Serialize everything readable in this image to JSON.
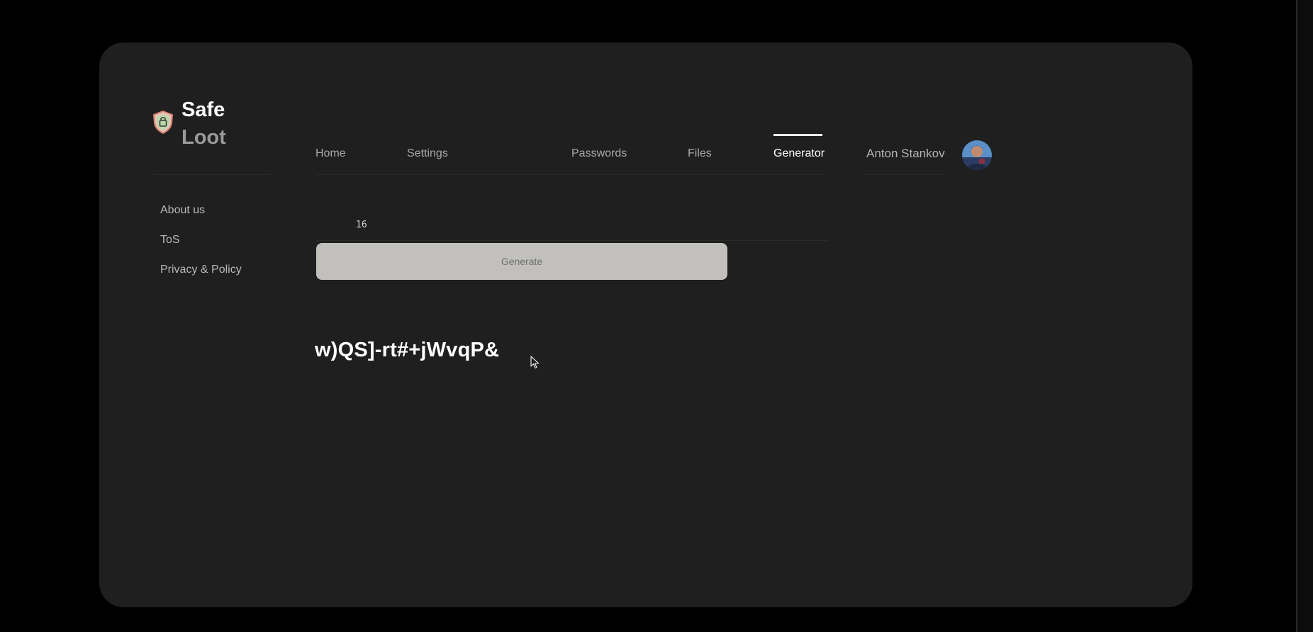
{
  "brand": {
    "line1": "Safe",
    "line2": "Loot"
  },
  "sidebar": {
    "links": [
      {
        "label": "About us"
      },
      {
        "label": "ToS"
      },
      {
        "label": "Privacy & Policy"
      }
    ]
  },
  "nav": {
    "items": [
      {
        "label": "Home"
      },
      {
        "label": "Settings"
      },
      {
        "label": "Passwords"
      },
      {
        "label": "Files"
      },
      {
        "label": "Generator",
        "active": true
      }
    ]
  },
  "user": {
    "name": "Anton Stankov"
  },
  "generator": {
    "length_value": "16",
    "button_label": "Generate",
    "result": "w)QS]-rt#+jWvqP&"
  },
  "icons": {
    "logo": "shield-lock-icon",
    "avatar": "user-avatar",
    "cursor": "mouse-pointer-icon"
  },
  "colors": {
    "background": "#000000",
    "card": "#1f1f1f",
    "button": "#c1c0bc",
    "active_text": "#ffffff",
    "muted_text": "#a9a9a9"
  }
}
